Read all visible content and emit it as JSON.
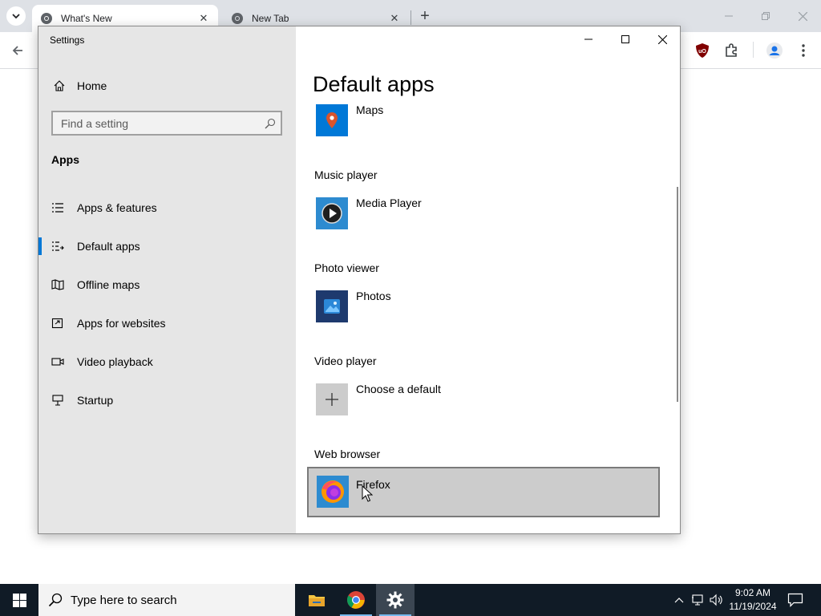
{
  "browser": {
    "tabs": [
      {
        "title": "What's New",
        "active": true
      },
      {
        "title": "New Tab",
        "active": false
      }
    ]
  },
  "settings": {
    "window_title": "Settings",
    "home_label": "Home",
    "search_placeholder": "Find a setting",
    "section": "Apps",
    "nav_items": [
      {
        "label": "Apps & features",
        "icon": "list-icon"
      },
      {
        "label": "Default apps",
        "icon": "default-apps-icon",
        "selected": true
      },
      {
        "label": "Offline maps",
        "icon": "map-icon"
      },
      {
        "label": "Apps for websites",
        "icon": "open-link-icon"
      },
      {
        "label": "Video playback",
        "icon": "video-icon"
      },
      {
        "label": "Startup",
        "icon": "startup-icon"
      }
    ],
    "page_title": "Default apps",
    "defaults": [
      {
        "category": "",
        "app": "Maps",
        "icon": "maps-icon"
      },
      {
        "category": "Music player",
        "app": "Media Player",
        "icon": "media-player-icon"
      },
      {
        "category": "Photo viewer",
        "app": "Photos",
        "icon": "photos-icon"
      },
      {
        "category": "Video player",
        "app": "Choose a default",
        "icon": "plus-icon"
      },
      {
        "category": "Web browser",
        "app": "Firefox",
        "icon": "firefox-icon"
      }
    ]
  },
  "taskbar": {
    "search_placeholder": "Type here to search",
    "time": "9:02 AM",
    "date": "11/19/2024"
  },
  "colors": {
    "accent": "#0078d7",
    "sidebar_bg": "#e6e6e6",
    "taskbar_bg": "#101b26"
  }
}
